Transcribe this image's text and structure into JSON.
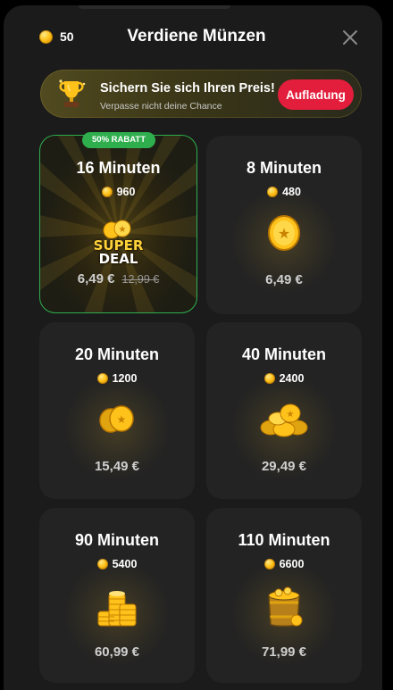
{
  "header": {
    "balance": "50",
    "title": "Verdiene Münzen",
    "close_icon": "close-icon"
  },
  "banner": {
    "icon": "trophy-icon",
    "title": "Sichern Sie sich Ihren Preis!",
    "subtitle": "Verpasse nicht deine Chance",
    "button_label": "Aufladung"
  },
  "packages": [
    {
      "name": "16 Minuten",
      "coins": "960",
      "badge": "50% RABATT",
      "deal_line1": "SUPER",
      "deal_line2": "DEAL",
      "price": "6,49 €",
      "old_price": "12,99 €",
      "icon": "coin-stack-icon"
    },
    {
      "name": "8 Minuten",
      "coins": "480",
      "price": "6,49 €",
      "icon": "single-coin-icon"
    },
    {
      "name": "20 Minuten",
      "coins": "1200",
      "price": "15,49 €",
      "icon": "coin-pair-icon"
    },
    {
      "name": "40 Minuten",
      "coins": "2400",
      "price": "29,49 €",
      "icon": "coin-pile-icon"
    },
    {
      "name": "90 Minuten",
      "coins": "5400",
      "price": "60,99 €",
      "icon": "coin-tower-icon"
    },
    {
      "name": "110 Minuten",
      "coins": "6600",
      "price": "71,99 €",
      "icon": "coin-barrel-icon"
    }
  ],
  "colors": {
    "accent_red": "#e31e3c",
    "discount_green": "#2fae4e",
    "coin_gold": "#ffc21a"
  }
}
